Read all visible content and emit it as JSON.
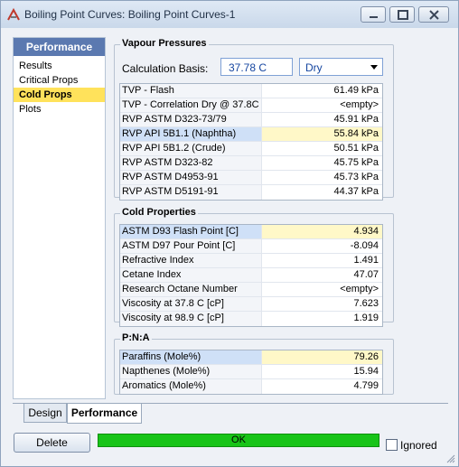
{
  "window": {
    "title": "Boiling Point Curves: Boiling Point Curves-1",
    "icon": "boiling-point-app-icon",
    "controls": [
      "minimize-icon",
      "maximize-icon",
      "close-icon"
    ]
  },
  "nav": {
    "header": "Performance",
    "items": [
      {
        "label": "Results",
        "active": false
      },
      {
        "label": "Critical Props",
        "active": false
      },
      {
        "label": "Cold Props",
        "active": true
      },
      {
        "label": "Plots",
        "active": false
      }
    ]
  },
  "vapour": {
    "title": "Vapour Pressures",
    "basis_label": "Calculation Basis:",
    "basis_temp": "37.78 C",
    "basis_selected": "Dry",
    "rows": [
      {
        "label": "TVP - Flash",
        "value": "61.49 kPa"
      },
      {
        "label": "TVP - Correlation Dry @ 37.8C",
        "value": "<empty>"
      },
      {
        "label": "RVP ASTM D323-73/79",
        "value": "45.91 kPa"
      },
      {
        "label": "RVP API 5B1.1 (Naphtha)",
        "value": "55.84 kPa"
      },
      {
        "label": "RVP API 5B1.2 (Crude)",
        "value": "50.51 kPa"
      },
      {
        "label": "RVP ASTM D323-82",
        "value": "45.75 kPa"
      },
      {
        "label": "RVP ASTM D4953-91",
        "value": "45.73 kPa"
      },
      {
        "label": "RVP ASTM D5191-91",
        "value": "44.37 kPa"
      }
    ]
  },
  "cold": {
    "title": "Cold Properties",
    "rows": [
      {
        "label": "ASTM D93 Flash Point [C]",
        "value": "4.934"
      },
      {
        "label": "ASTM D97 Pour Point [C]",
        "value": "-8.094"
      },
      {
        "label": "Refractive Index",
        "value": "1.491"
      },
      {
        "label": "Cetane Index",
        "value": "47.07"
      },
      {
        "label": "Research Octane Number",
        "value": "<empty>"
      },
      {
        "label": "Viscosity at 37.8 C [cP]",
        "value": "7.623"
      },
      {
        "label": "Viscosity at 98.9 C [cP]",
        "value": "1.919"
      }
    ]
  },
  "pna": {
    "title": "P:N:A",
    "rows": [
      {
        "label": "Paraffins (Mole%)",
        "value": "79.26"
      },
      {
        "label": "Napthenes (Mole%)",
        "value": "15.94"
      },
      {
        "label": "Aromatics (Mole%)",
        "value": "4.799"
      }
    ]
  },
  "tabs": {
    "design": "Design",
    "performance": "Performance"
  },
  "footer": {
    "delete": "Delete",
    "status": "OK",
    "ignored": "Ignored",
    "status_color": "#18c418"
  }
}
